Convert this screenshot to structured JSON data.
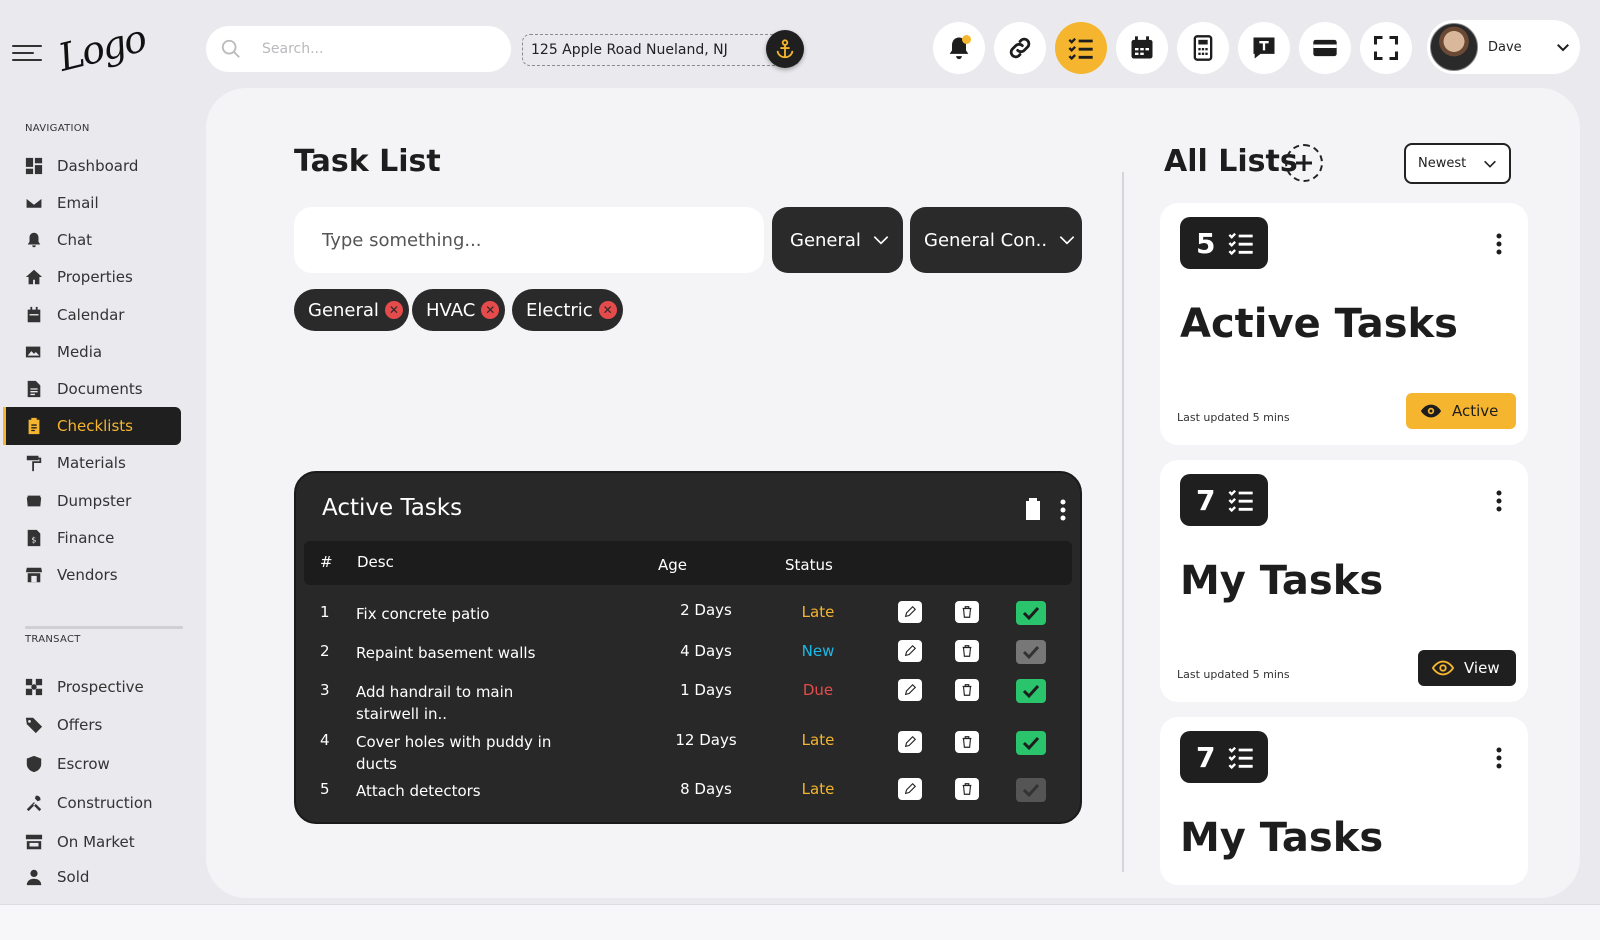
{
  "brand": {
    "logo_text": "Logo"
  },
  "colors": {
    "accent": "#f5b52e",
    "dark": "#282828",
    "success": "#29c46b",
    "danger": "#e54b4b",
    "info": "#1db8e6"
  },
  "sidebar": {
    "navigation_label": "NAVIGATION",
    "navigation": [
      {
        "label": "Dashboard",
        "icon": "dashboard-icon"
      },
      {
        "label": "Email",
        "icon": "envelope-icon"
      },
      {
        "label": "Chat",
        "icon": "bell-icon"
      },
      {
        "label": "Properties",
        "icon": "house-icon"
      },
      {
        "label": "Calendar",
        "icon": "calendar-icon"
      },
      {
        "label": "Media",
        "icon": "images-icon"
      },
      {
        "label": "Documents",
        "icon": "document-icon"
      },
      {
        "label": "Checklists",
        "icon": "clipboard-icon",
        "active": true
      },
      {
        "label": "Materials",
        "icon": "paint-roller-icon"
      },
      {
        "label": "Dumpster",
        "icon": "dumpster-icon"
      },
      {
        "label": "Finance",
        "icon": "invoice-icon"
      },
      {
        "label": "Vendors",
        "icon": "store-icon"
      }
    ],
    "transact_label": "TRANSACT",
    "transact": [
      {
        "label": "Prospective",
        "icon": "prospect-icon"
      },
      {
        "label": "Offers",
        "icon": "tag-icon"
      },
      {
        "label": "Escrow",
        "icon": "shield-icon"
      },
      {
        "label": "Construction",
        "icon": "tools-icon"
      },
      {
        "label": "On Market",
        "icon": "storefront-icon"
      },
      {
        "label": "Sold",
        "icon": "person-icon"
      }
    ]
  },
  "topbar": {
    "search_placeholder": "Search...",
    "address": "125 Apple Road Nueland, NJ",
    "tools": [
      "bell-icon",
      "link-icon",
      "checklist-icon",
      "calendar-icon",
      "calculator-icon",
      "message-icon",
      "card-icon",
      "fullscreen-icon"
    ],
    "active_tool": "checklist-icon",
    "user_name": "Dave"
  },
  "task_list": {
    "title": "Task List",
    "input_placeholder": "Type something...",
    "category_dropdown": "General",
    "subcategory_dropdown": "General Con..",
    "tags": [
      "General",
      "HVAC",
      "Electric"
    ]
  },
  "active_tasks": {
    "title": "Active Tasks",
    "columns": {
      "num": "#",
      "desc": "Desc",
      "age": "Age",
      "status": "Status"
    },
    "rows": [
      {
        "num": "1",
        "desc": "Fix concrete patio",
        "age": "2 Days",
        "status": "Late",
        "done": true
      },
      {
        "num": "2",
        "desc": "Repaint basement walls",
        "age": "4 Days",
        "status": "New",
        "done": false
      },
      {
        "num": "3",
        "desc": "Add handrail to main stairwell in..",
        "age": "1 Days",
        "status": "Due",
        "done": true
      },
      {
        "num": "4",
        "desc": "Cover holes with puddy in ducts",
        "age": "12 Days",
        "status": "Late",
        "done": true
      },
      {
        "num": "5",
        "desc": "Attach detectors",
        "age": "8 Days",
        "status": "Late",
        "done": false
      }
    ]
  },
  "all_lists": {
    "title": "All Lists",
    "sort": "Newest",
    "cards": [
      {
        "count": "5",
        "title": "Active Tasks",
        "updated": "Last updated 5 mins",
        "button": "Active"
      },
      {
        "count": "7",
        "title": "My Tasks",
        "updated": "Last updated 5 mins",
        "button": "View"
      },
      {
        "count": "7",
        "title": "My Tasks"
      }
    ]
  }
}
